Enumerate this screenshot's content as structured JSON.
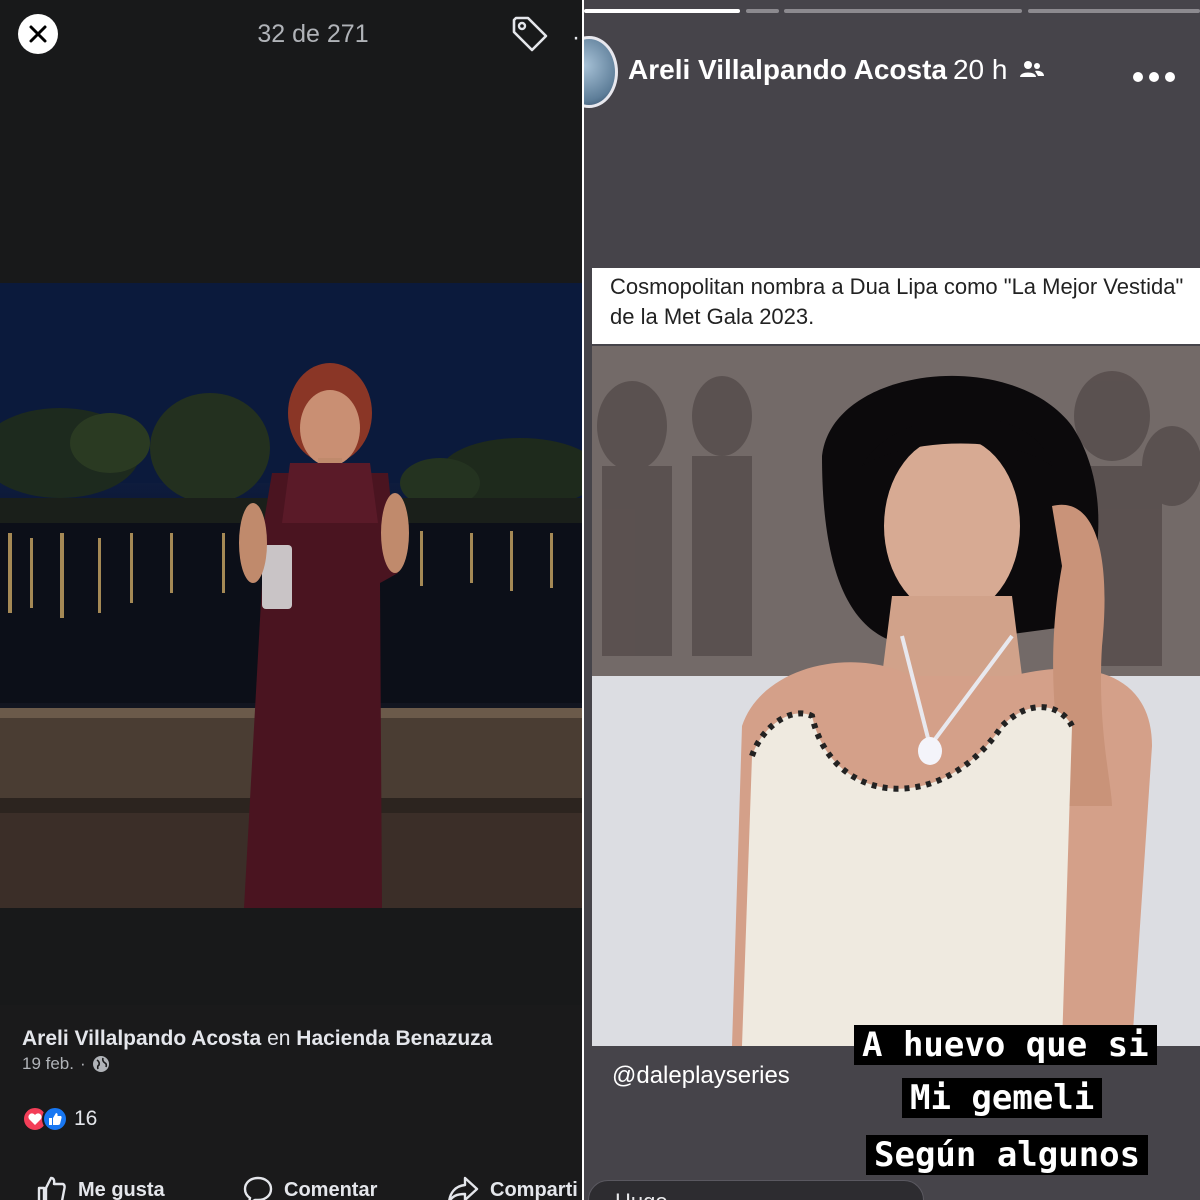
{
  "viewer": {
    "counter": "32 de 271",
    "close_icon": "close-icon",
    "tag_icon": "tag-icon"
  },
  "post": {
    "author": "Areli Villalpando Acosta",
    "connector": "en",
    "place": "Hacienda Benazuza",
    "date": "19 feb.",
    "separator": "·",
    "privacy_icon": "globe-icon",
    "reaction_count": "16",
    "reactions": [
      "love-icon",
      "like-icon"
    ],
    "actions": {
      "like": "Me gusta",
      "comment": "Comentar",
      "share": "Comparti"
    }
  },
  "story": {
    "author": "Areli Villalpando Acosta",
    "time": "20 h",
    "audience_icon": "friends-icon",
    "more_icon": "more-icon",
    "progress_segments": 4,
    "current_segment": 1,
    "card_title": "Cosmopolitan nombra a Dua Lipa como \"La Mejor Vestida\" de la Met Gala 2023.",
    "handle": "@daleplayseries",
    "captions": [
      "A huevo que si",
      "Mi gemeli",
      "Según algunos"
    ],
    "reply_placeholder": "Hugo"
  },
  "colors": {
    "background": "#18191a",
    "story_background": "#46444a",
    "love": "#f33e58",
    "like": "#1877f2"
  }
}
